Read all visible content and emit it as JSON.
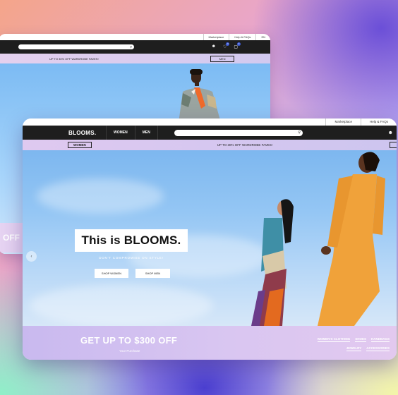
{
  "back_window": {
    "util_links": [
      "Marketplace",
      "Help & FAQs",
      "EN"
    ],
    "promo_text": "UP TO 30% OFF WARDROBE FAVES!",
    "promo_button": "MEN",
    "badge_wishlist": "0",
    "badge_cart": "0",
    "side_text": "OFF"
  },
  "front_window": {
    "util_links": [
      "Marketplace",
      "Help & FAQs"
    ],
    "logo": "BLOOMS.",
    "nav": {
      "women": "WOMEN",
      "men": "MEN"
    },
    "promo_button": "WOMEN",
    "promo_text": "UP TO 30% OFF WARDROBE FAVES!",
    "hero": {
      "headline": "This is BLOOMS.",
      "tagline": "DON'T COMPROMISE ON STYLE!",
      "btn_women": "SHOP WOMEN",
      "btn_men": "SHOP MEN"
    },
    "footer": {
      "headline": "GET UP TO $300 OFF",
      "subline": "Your Purchase",
      "links": [
        "WOMEN'S CLOTHING",
        "SHOES",
        "HANDBAGS",
        "JEWELRY",
        "ACCESSORIES"
      ]
    }
  },
  "colors": {
    "nav_bg": "#1e1e1e",
    "accent": "#3d5bd9",
    "promo_bg": "#dfc9f0"
  },
  "icons": [
    "search-icon",
    "user-icon",
    "heart-icon",
    "bag-icon",
    "chevron-left-icon"
  ]
}
